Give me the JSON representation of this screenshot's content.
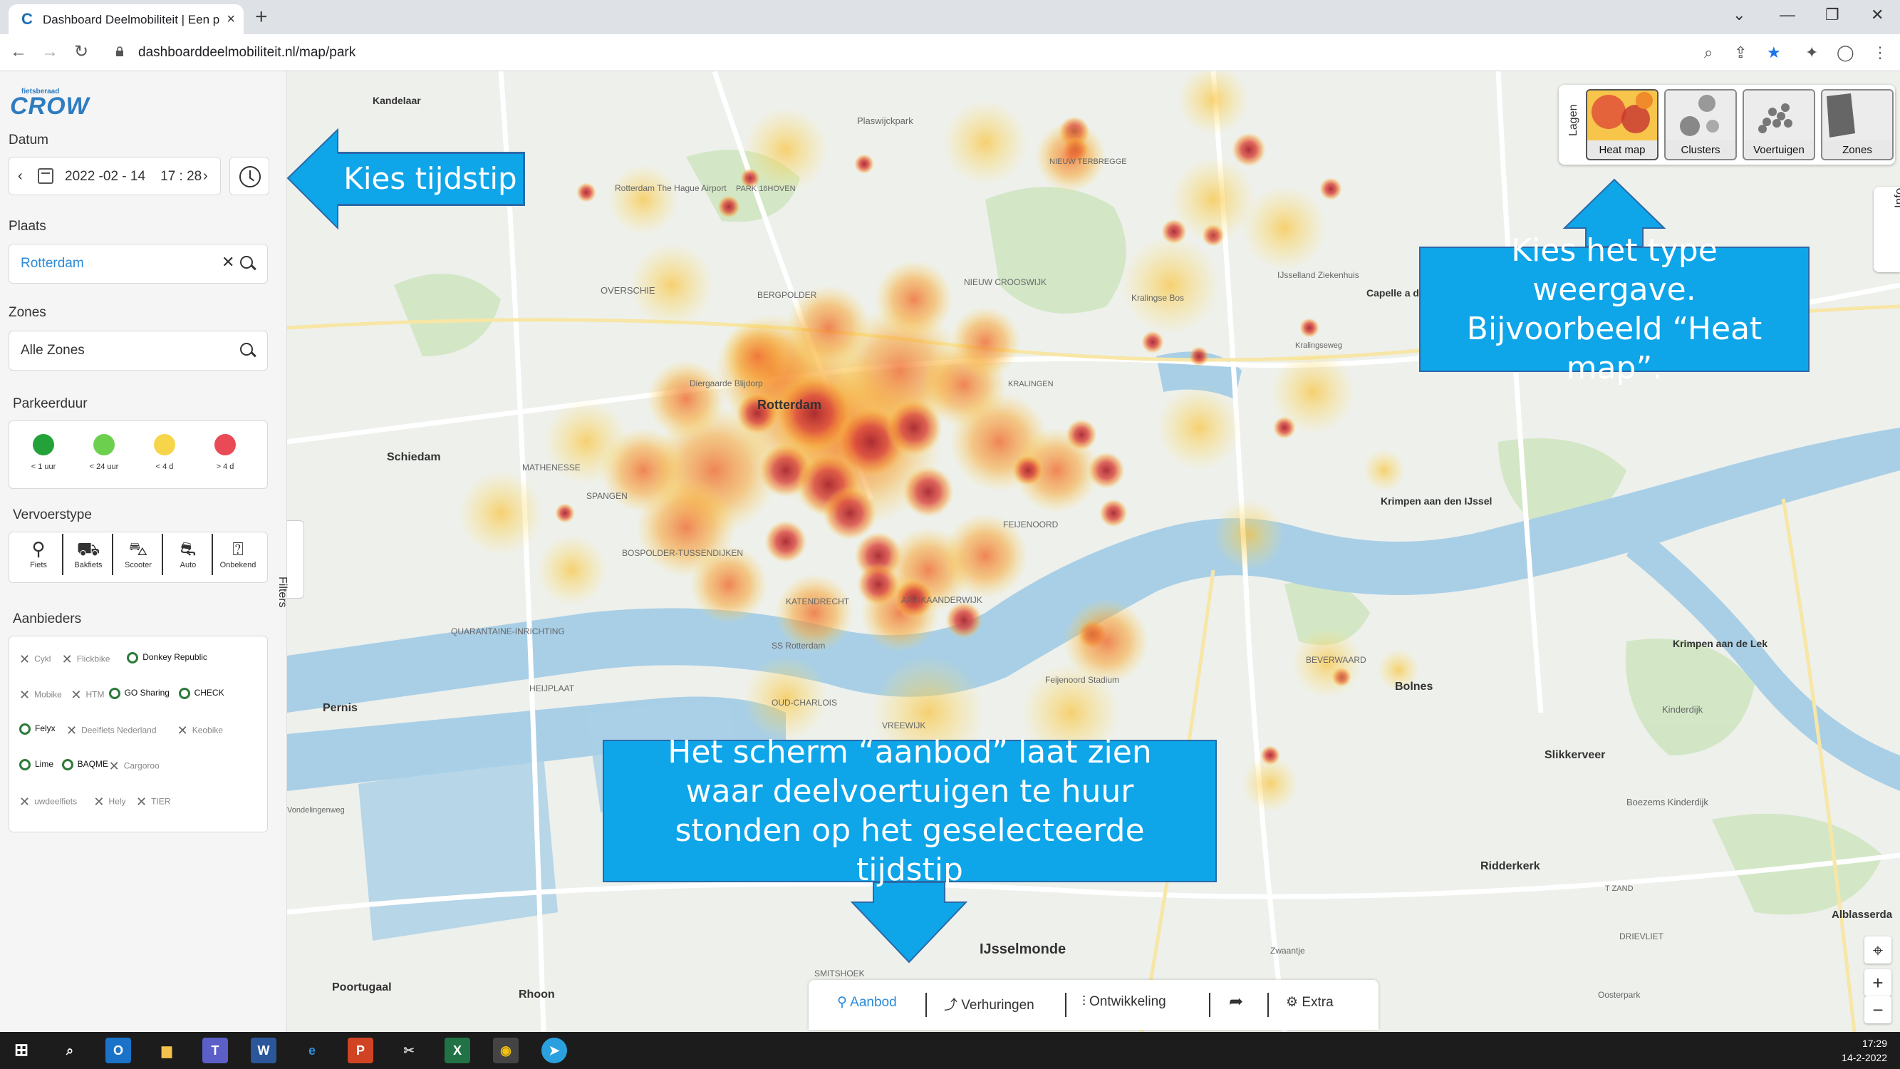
{
  "browser": {
    "tab_title": "Dashboard Deelmobiliteit | Een p",
    "url": "dashboarddeelmobiliteit.nl/map/park",
    "new_tab": "+",
    "tab_close": "×"
  },
  "logo": {
    "brand": "CROW",
    "sub": "fietsberaad"
  },
  "sidebar": {
    "datum_label": "Datum",
    "date_value": "2022 -02 - 14    17 : 28",
    "plaats_label": "Plaats",
    "plaats_value": "Rotterdam",
    "zones_label": "Zones",
    "zones_value": "Alle Zones",
    "parkeerduur_label": "Parkeerduur",
    "parkeerduur": [
      {
        "label": "< 1 uur",
        "color": "#23a23a"
      },
      {
        "label": "< 24 uur",
        "color": "#6cd04e"
      },
      {
        "label": "< 4 d",
        "color": "#f6d54a"
      },
      {
        "label": "> 4 d",
        "color": "#ea4a55"
      }
    ],
    "vervoerstype_label": "Vervoerstype",
    "vervoerstypes": [
      {
        "label": "Fiets",
        "icon": "bicycle-icon"
      },
      {
        "label": "Bakfiets",
        "icon": "cargo-bike-icon"
      },
      {
        "label": "Scooter",
        "icon": "scooter-icon"
      },
      {
        "label": "Auto",
        "icon": "car-icon"
      },
      {
        "label": "Onbekend",
        "icon": "unknown-vehicle-icon"
      }
    ],
    "aanbieders_label": "Aanbieders",
    "aanbieders": [
      {
        "name": "Cykl",
        "active": false
      },
      {
        "name": "Flickbike",
        "active": false
      },
      {
        "name": "Donkey Republic",
        "active": true
      },
      {
        "name": "Mobike",
        "active": false
      },
      {
        "name": "HTM",
        "active": false
      },
      {
        "name": "GO Sharing",
        "active": true
      },
      {
        "name": "CHECK",
        "active": true
      },
      {
        "name": "Felyx",
        "active": true
      },
      {
        "name": "Deelfiets Nederland",
        "active": false
      },
      {
        "name": "Keobike",
        "active": false
      },
      {
        "name": "Lime",
        "active": true
      },
      {
        "name": "BAQME",
        "active": true
      },
      {
        "name": "Cargoroo",
        "active": false
      },
      {
        "name": "uwdeelfiets",
        "active": false
      },
      {
        "name": "Hely",
        "active": false
      },
      {
        "name": "TIER",
        "active": false
      }
    ],
    "filters_tab": "Filters"
  },
  "layers": {
    "label": "Lagen",
    "options": [
      "Heat map",
      "Clusters",
      "Voertuigen",
      "Zones"
    ],
    "selected": "Heat map"
  },
  "info_tab": "Info",
  "bottom_nav": {
    "items": [
      "Aanbod",
      "Verhuringen",
      "Ontwikkeling",
      "Extra"
    ],
    "active": "Aanbod"
  },
  "callouts": {
    "time": "Kies tijdstip",
    "type": "Kies het type weergave. Bijvoorbeeld “Heat map”.",
    "aanbod": "Het scherm “aanbod” laat zien waar deelvoertuigen te huur stonden op het geselecteerde tijdstip"
  },
  "map_labels": [
    "Kandelaar",
    "Plaswijckpark",
    "Rotterdam The Hague Airport",
    "PARK 16HOVEN",
    "OVERSCHIE",
    "BERGPOLDER",
    "NIEUW CROOSWIJK",
    "Kralingse Bos",
    "IJsselland Ziekenhuis",
    "Capelle a den IJss",
    "Diergaarde Blijdorp",
    "Rotterdam",
    "KRALINGEN",
    "Schiedam",
    "MATHENESSE",
    "SPANGEN",
    "BOSPOLDER-TUSSENDIJKEN",
    "FEIJENOORD",
    "Krimpen aan den IJssel",
    "QUARANTAINE-INRICHTING",
    "KATENDRECHT",
    "AFRIKAANDERWIJK",
    "SS Rotterdam",
    "Feijenoord Stadium",
    "BEVERWAARD",
    "Bolnes",
    "Krimpen aan de Lek",
    "Kinderdijk",
    "Pernis",
    "HEIJPLAAT",
    "OUD-CHARLOIS",
    "VREEWIJK",
    "Slikkerveer",
    "Boezems Kinderdijk",
    "Ridderkerk",
    "IJsselmonde",
    "Zwaantje",
    "DRIEVLIET",
    "Alblasserda",
    "Poortugaal",
    "Rhoon",
    "SMITSHOEK",
    "Oosterpark",
    "NIEUW TERBREGGE",
    "Kralingseweg",
    "Vondelingenweg",
    "T ZAND"
  ],
  "taskbar": {
    "time": "17:29",
    "date": "14-2-2022"
  },
  "colors": {
    "callout": "#0ea5e9",
    "accent": "#2b8ad8",
    "heat_hot": "#b8323a",
    "heat_mid": "#f08a2b",
    "heat_low": "#fbd44b"
  }
}
